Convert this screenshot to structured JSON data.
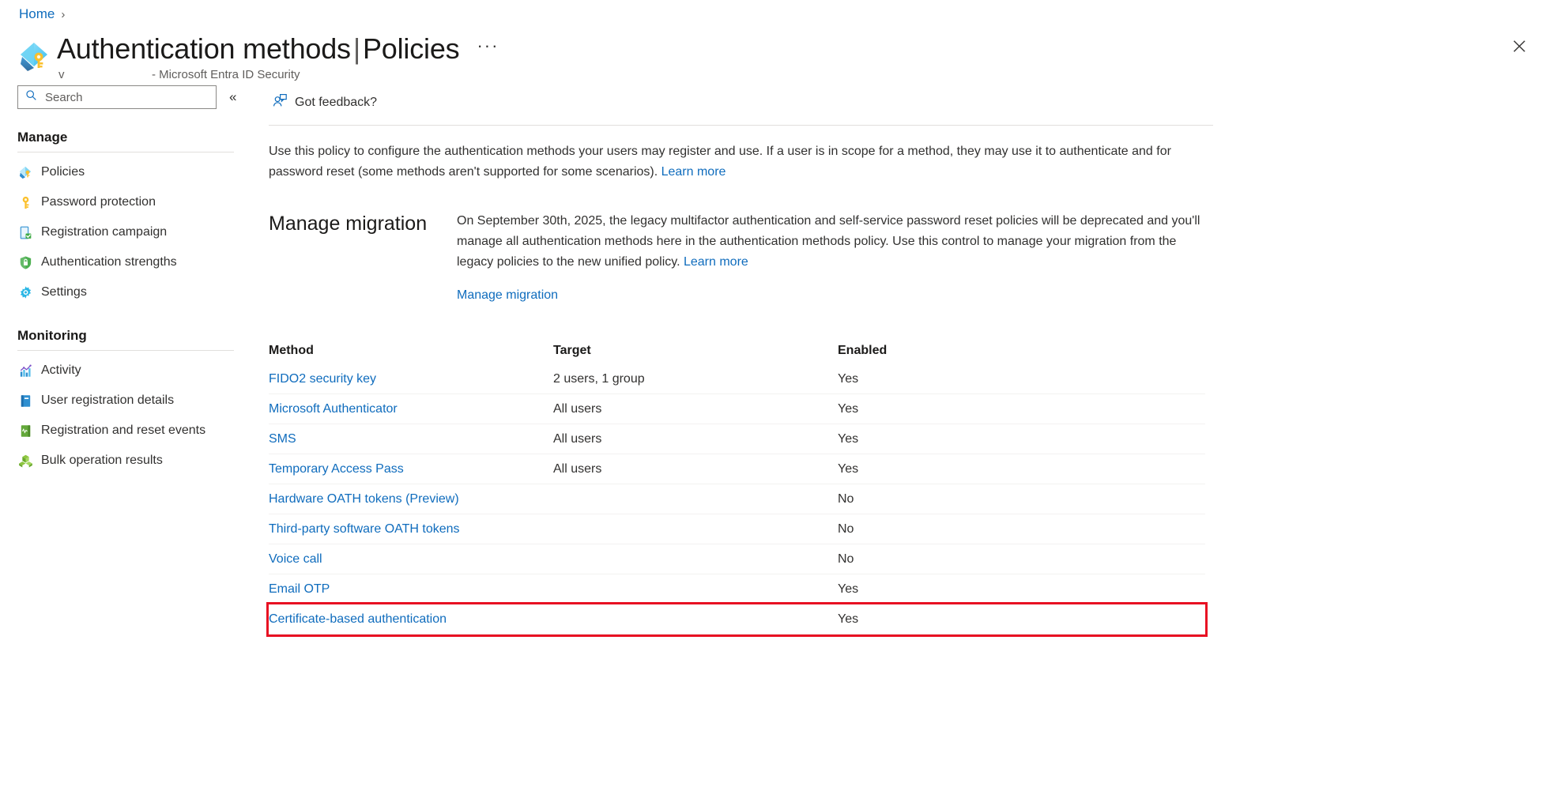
{
  "breadcrumb": {
    "home": "Home",
    "separator": "›"
  },
  "header": {
    "title_main": "Authentication methods",
    "title_separator": "|",
    "title_sub": "Policies",
    "ellipsis": "···",
    "tenant": "v",
    "subtitle_suffix": "- Microsoft Entra ID Security",
    "close_label": "✕"
  },
  "search": {
    "placeholder": "Search",
    "value": "",
    "collapse": "«"
  },
  "sidebar": {
    "groups": [
      {
        "label": "Manage",
        "items": [
          {
            "label": "Policies",
            "icon": "policies-icon"
          },
          {
            "label": "Password protection",
            "icon": "key-icon"
          },
          {
            "label": "Registration campaign",
            "icon": "registration-campaign-icon"
          },
          {
            "label": "Authentication strengths",
            "icon": "shield-lock-icon"
          },
          {
            "label": "Settings",
            "icon": "gear-icon"
          }
        ]
      },
      {
        "label": "Monitoring",
        "items": [
          {
            "label": "Activity",
            "icon": "activity-chart-icon"
          },
          {
            "label": "User registration details",
            "icon": "user-registration-book-icon"
          },
          {
            "label": "Registration and reset events",
            "icon": "events-book-icon"
          },
          {
            "label": "Bulk operation results",
            "icon": "bulk-operations-icon"
          }
        ]
      }
    ]
  },
  "commandbar": {
    "feedback_label": "Got feedback?"
  },
  "intro": {
    "text_before_link": "Use this policy to configure the authentication methods your users may register and use. If a user is in scope for a method, they may use it to authenticate and for password reset (some methods aren't supported for some scenarios). ",
    "link_label": "Learn more"
  },
  "migration": {
    "title": "Manage migration",
    "text_before_link": "On September 30th, 2025, the legacy multifactor authentication and self-service password reset policies will be deprecated and you'll manage all authentication methods here in the authentication methods policy. Use this control to manage your migration from the legacy policies to the new unified policy. ",
    "link_label": "Learn more",
    "action_link": "Manage migration"
  },
  "methods_table": {
    "columns": {
      "method": "Method",
      "target": "Target",
      "enabled": "Enabled"
    },
    "rows": [
      {
        "method": "FIDO2 security key",
        "target": "2 users, 1 group",
        "enabled": "Yes",
        "highlighted": false
      },
      {
        "method": "Microsoft Authenticator",
        "target": "All users",
        "enabled": "Yes",
        "highlighted": false
      },
      {
        "method": "SMS",
        "target": "All users",
        "enabled": "Yes",
        "highlighted": false
      },
      {
        "method": "Temporary Access Pass",
        "target": "All users",
        "enabled": "Yes",
        "highlighted": false
      },
      {
        "method": "Hardware OATH tokens (Preview)",
        "target": "",
        "enabled": "No",
        "highlighted": false
      },
      {
        "method": "Third-party software OATH tokens",
        "target": "",
        "enabled": "No",
        "highlighted": false
      },
      {
        "method": "Voice call",
        "target": "",
        "enabled": "No",
        "highlighted": false
      },
      {
        "method": "Email OTP",
        "target": "",
        "enabled": "Yes",
        "highlighted": false
      },
      {
        "method": "Certificate-based authentication",
        "target": "",
        "enabled": "Yes",
        "highlighted": true
      }
    ]
  },
  "colors": {
    "link": "#0f6cbd",
    "highlight": "#e81123",
    "text": "#323130",
    "muted": "#605e5c",
    "rule": "#e1dfdd"
  }
}
